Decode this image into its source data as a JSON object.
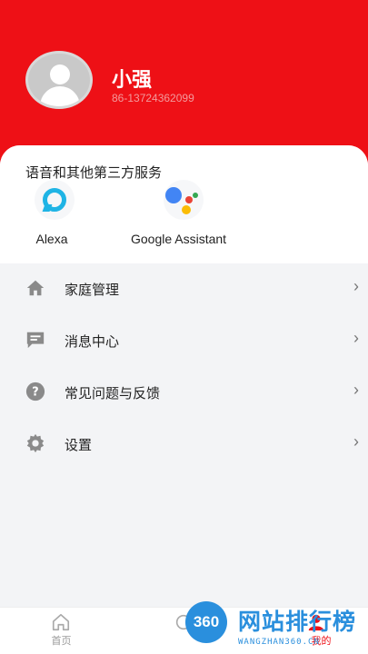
{
  "profile": {
    "name": "小强",
    "phone": "86-13724362099"
  },
  "services": {
    "title": "语音和其他第三方服务",
    "items": [
      {
        "label": "Alexa",
        "icon": "alexa-icon"
      },
      {
        "label": "Google Assistant",
        "icon": "google-assistant-icon"
      }
    ]
  },
  "menu": {
    "items": [
      {
        "label": "家庭管理",
        "icon": "home-icon"
      },
      {
        "label": "消息中心",
        "icon": "message-icon"
      },
      {
        "label": "常见问题与反馈",
        "icon": "help-icon"
      },
      {
        "label": "设置",
        "icon": "gear-icon"
      }
    ]
  },
  "tabbar": {
    "items": [
      {
        "label": "首页",
        "icon": "home-outline-icon",
        "active": false
      },
      {
        "label": "",
        "icon": "scene-icon",
        "active": false
      },
      {
        "label": "我的",
        "icon": "profile-icon",
        "active": true
      }
    ]
  },
  "watermark": {
    "badge": "360",
    "title": "网站排行榜",
    "subtitle": "WANGZHAN360.CN"
  },
  "colors": {
    "brand_red": "#ee1016",
    "alexa_blue": "#1fb4e5",
    "google_blue": "#4285f4",
    "google_red": "#ea4335",
    "google_yellow": "#fbbc05",
    "google_green": "#34a853",
    "icon_gray": "#8a8a8a",
    "watermark_blue": "#2a8fdd"
  }
}
